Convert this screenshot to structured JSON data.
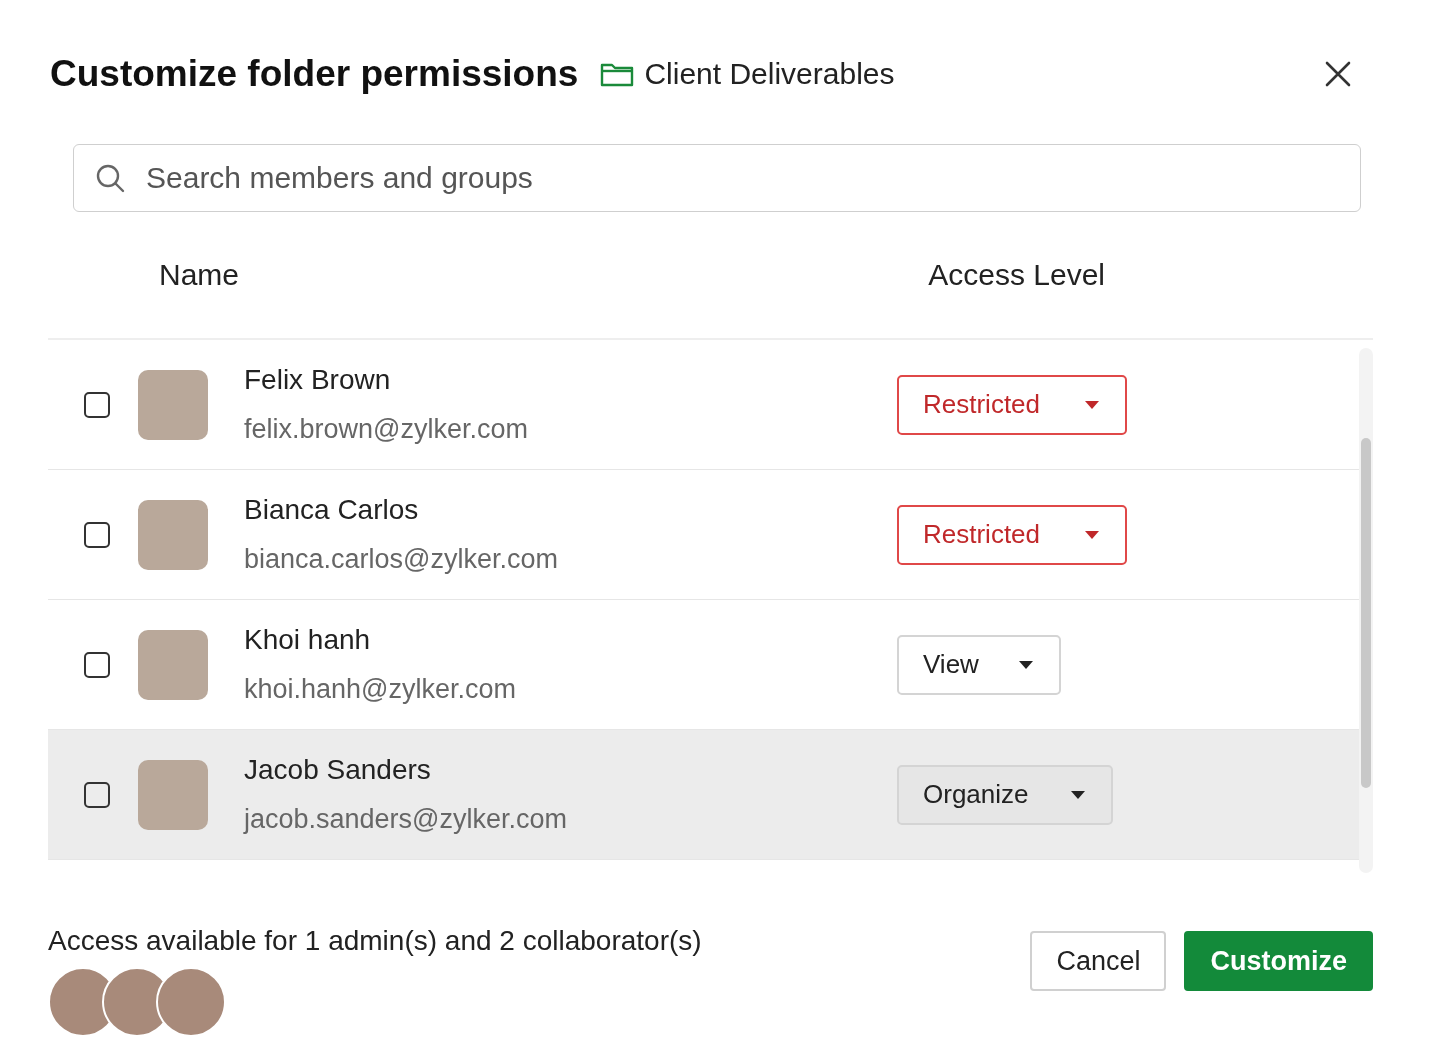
{
  "dialog": {
    "title": "Customize folder permissions",
    "folder": "Client Deliverables"
  },
  "search": {
    "placeholder": "Search members and groups"
  },
  "table": {
    "columns": [
      "Name",
      "Access Level"
    ],
    "rows": [
      {
        "name": "Felix Brown",
        "email": "felix.brown@zylker.com",
        "checked": false,
        "highlighted": false,
        "access": {
          "label": "Restricted",
          "kind": "restricted"
        }
      },
      {
        "name": "Bianca Carlos",
        "email": "bianca.carlos@zylker.com",
        "checked": false,
        "highlighted": false,
        "access": {
          "label": "Restricted",
          "kind": "restricted"
        }
      },
      {
        "name": "Khoi hanh",
        "email": "khoi.hanh@zylker.com",
        "checked": false,
        "highlighted": false,
        "access": {
          "label": "View",
          "kind": "view"
        }
      },
      {
        "name": "Jacob Sanders",
        "email": "jacob.sanders@zylker.com",
        "checked": false,
        "highlighted": true,
        "access": {
          "label": "Organize",
          "kind": "organize"
        }
      }
    ]
  },
  "footer": {
    "summary": "Access available for 1 admin(s) and 2 collaborator(s)"
  },
  "buttons": [
    {
      "label": "Cancel",
      "kind": "secondary"
    },
    {
      "label": "Customize",
      "kind": "primary"
    }
  ]
}
